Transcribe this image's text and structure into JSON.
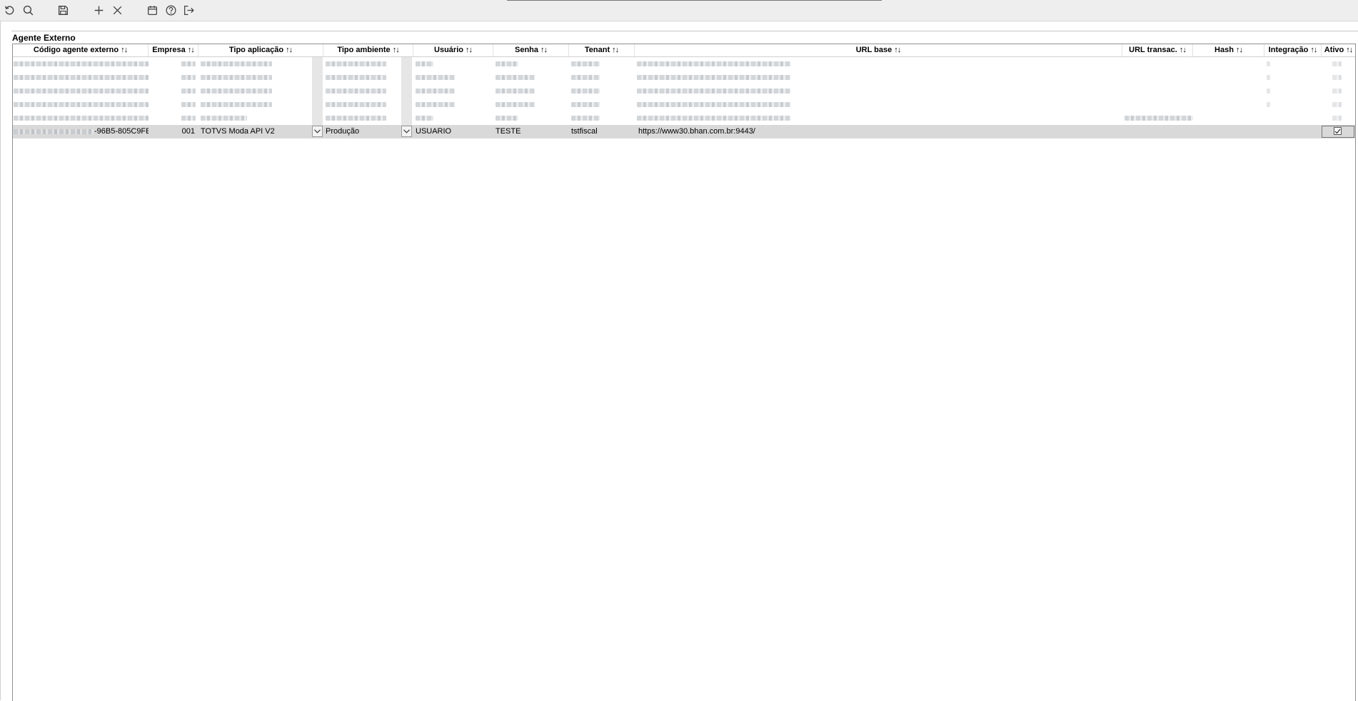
{
  "toolbar": {
    "buttons": [
      {
        "name": "refresh-button",
        "icon": "refresh-icon"
      },
      {
        "name": "search-button",
        "icon": "search-icon"
      },
      {
        "name": "save-button",
        "icon": "save-icon"
      },
      {
        "name": "add-button",
        "icon": "plus-icon"
      },
      {
        "name": "delete-button",
        "icon": "close-icon"
      },
      {
        "name": "calendar-button",
        "icon": "calendar-icon"
      },
      {
        "name": "help-button",
        "icon": "help-icon"
      },
      {
        "name": "exit-button",
        "icon": "exit-icon"
      }
    ]
  },
  "panel": {
    "title": "Agente Externo"
  },
  "grid": {
    "sort_glyph": "↑↓",
    "columns": [
      {
        "key": "codigo",
        "label": "Código agente externo"
      },
      {
        "key": "empresa",
        "label": "Empresa"
      },
      {
        "key": "tipo_aplicacao",
        "label": "Tipo aplicação"
      },
      {
        "key": "tipo_ambiente",
        "label": "Tipo ambiente"
      },
      {
        "key": "usuario",
        "label": "Usuário"
      },
      {
        "key": "senha",
        "label": "Senha"
      },
      {
        "key": "tenant",
        "label": "Tenant"
      },
      {
        "key": "url_base",
        "label": "URL base"
      },
      {
        "key": "url_transac",
        "label": "URL transac."
      },
      {
        "key": "hash",
        "label": "Hash"
      },
      {
        "key": "integracao",
        "label": "Integração"
      },
      {
        "key": "ativo",
        "label": "Ativo"
      }
    ],
    "blurred_row_count": 5,
    "selected_row": {
      "codigo_suffix": "-96B5-805C9FE",
      "empresa": "001",
      "tipo_aplicacao": "TOTVS Moda API V2",
      "tipo_ambiente": "Produção",
      "usuario": "USUARIO",
      "senha": "TESTE",
      "tenant": "tstfiscal",
      "url_base": "https://www30.bhan.com.br:9443/",
      "ativo": true
    }
  },
  "colors": {
    "toolbar_bg": "#eeeeee",
    "selected_row_bg": "#d9d9d9",
    "grid_border": "#8f8f8f"
  }
}
